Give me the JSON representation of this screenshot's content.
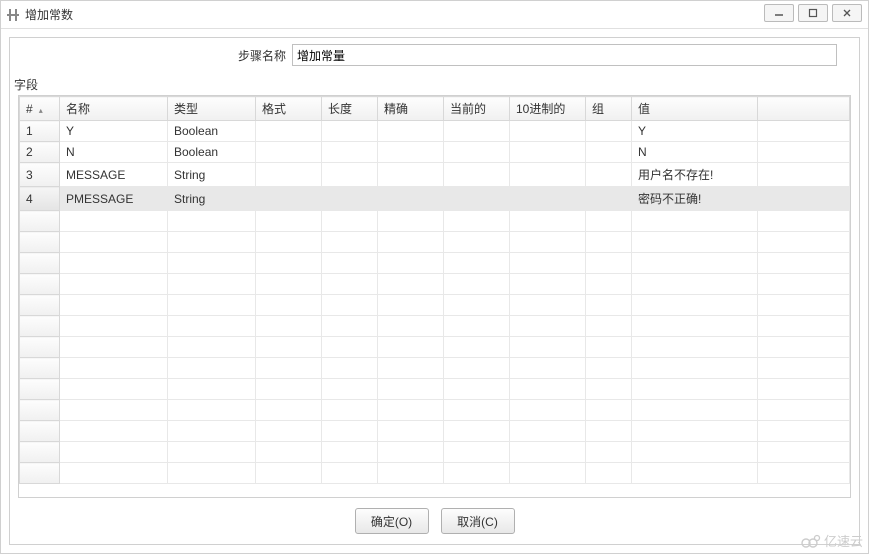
{
  "window": {
    "title": "增加常数"
  },
  "step": {
    "label": "步骤名称",
    "value": "增加常量"
  },
  "section_label": "字段",
  "columns": {
    "hash": "#",
    "name": "名称",
    "type": "类型",
    "format": "格式",
    "length": "长度",
    "precision": "精确",
    "current": "当前的",
    "decimal": "10进制的",
    "group": "组",
    "value": "值"
  },
  "rows": [
    {
      "num": "1",
      "name": "Y",
      "type": "Boolean",
      "format": "",
      "length": "",
      "precision": "",
      "current": "",
      "decimal": "",
      "group": "",
      "value": "Y",
      "selected": false
    },
    {
      "num": "2",
      "name": "N",
      "type": "Boolean",
      "format": "",
      "length": "",
      "precision": "",
      "current": "",
      "decimal": "",
      "group": "",
      "value": "N",
      "selected": false
    },
    {
      "num": "3",
      "name": "MESSAGE",
      "type": "String",
      "format": "",
      "length": "",
      "precision": "",
      "current": "",
      "decimal": "",
      "group": "",
      "value": "用户名不存在!",
      "selected": false
    },
    {
      "num": "4",
      "name": "PMESSAGE",
      "type": "String",
      "format": "",
      "length": "",
      "precision": "",
      "current": "",
      "decimal": "",
      "group": "",
      "value": "密码不正确!",
      "selected": true
    }
  ],
  "buttons": {
    "ok": "确定(O)",
    "cancel": "取消(C)"
  },
  "watermark": "亿速云"
}
